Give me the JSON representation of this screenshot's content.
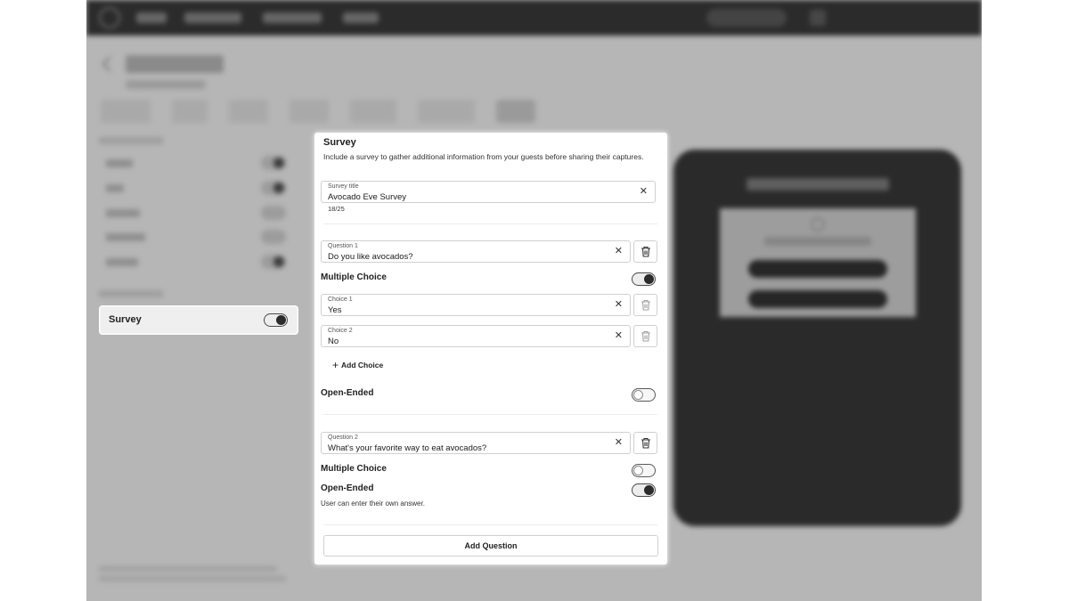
{
  "sidebar": {
    "survey_label": "Survey",
    "survey_enabled": true
  },
  "survey_panel": {
    "title": "Survey",
    "description": "Include a survey to gather additional information from your guests before sharing their captures.",
    "survey_title": {
      "label": "Survey title",
      "value": "Avocado Eve Survey",
      "counter": "18/25"
    },
    "questions": [
      {
        "label": "Question 1",
        "value": "Do you like avocados?",
        "multiple_choice_label": "Multiple Choice",
        "multiple_choice_on": true,
        "choices": [
          {
            "label": "Choice 1",
            "value": "Yes"
          },
          {
            "label": "Choice 2",
            "value": "No"
          }
        ],
        "add_choice_label": "Add Choice",
        "open_ended_label": "Open-Ended",
        "open_ended_on": false
      },
      {
        "label": "Question 2",
        "value": "What's your favorite way to eat avocados?",
        "multiple_choice_label": "Multiple Choice",
        "multiple_choice_on": false,
        "open_ended_label": "Open-Ended",
        "open_ended_on": true,
        "open_ended_help": "User can enter their own answer."
      }
    ],
    "add_question_label": "Add Question"
  },
  "icons": {
    "clear": "close-icon",
    "delete": "trash-icon",
    "add": "plus-icon"
  }
}
